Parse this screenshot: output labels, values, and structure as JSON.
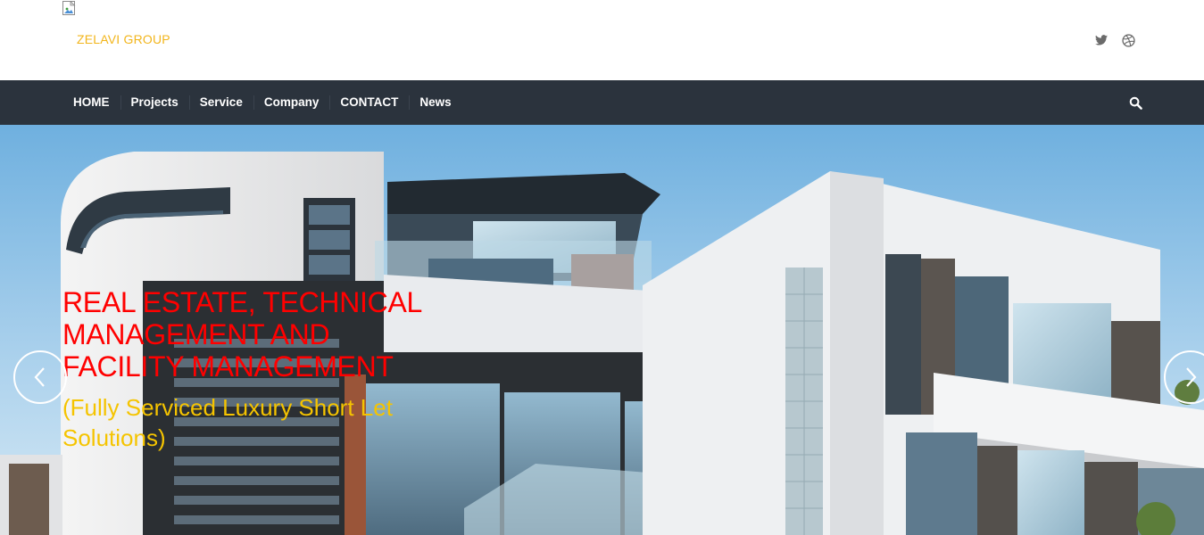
{
  "header": {
    "brand": "ZELAVI GROUP",
    "social_icons": [
      "twitter-icon",
      "dribbble-icon"
    ]
  },
  "nav": {
    "items": [
      "HOME",
      "Projects",
      "Service",
      "Company",
      "CONTACT",
      "News"
    ],
    "search_icon": "search-icon"
  },
  "hero": {
    "title": "REAL ESTATE, TECHNICAL MANAGEMENT AND FACILITY MANAGEMENT",
    "subtitle": "(Fully Serviced Luxury Short Let Solutions)",
    "prev_icon": "chevron-left-icon",
    "next_icon": "chevron-right-icon"
  },
  "colors": {
    "brand": "#f2b51b",
    "nav_bg": "#2b333d",
    "hero_title": "#ff0000",
    "hero_subtitle": "#f5c400"
  }
}
